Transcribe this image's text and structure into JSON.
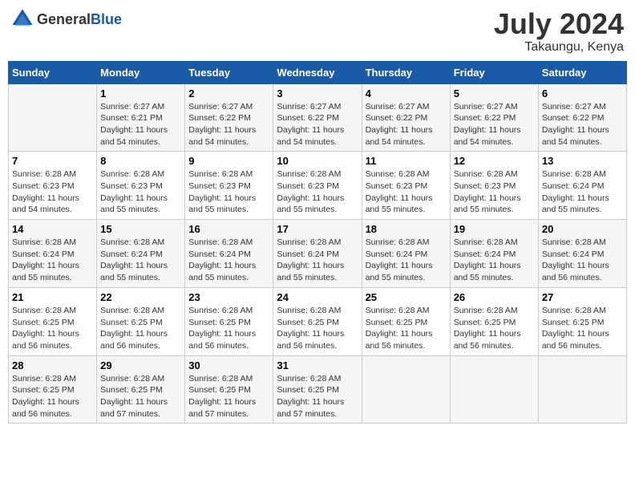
{
  "logo": {
    "general": "General",
    "blue": "Blue"
  },
  "title": "July 2024",
  "location": "Takaungu, Kenya",
  "days_header": [
    "Sunday",
    "Monday",
    "Tuesday",
    "Wednesday",
    "Thursday",
    "Friday",
    "Saturday"
  ],
  "weeks": [
    [
      {
        "day": "",
        "info": ""
      },
      {
        "day": "1",
        "info": "Sunrise: 6:27 AM\nSunset: 6:21 PM\nDaylight: 11 hours\nand 54 minutes."
      },
      {
        "day": "2",
        "info": "Sunrise: 6:27 AM\nSunset: 6:22 PM\nDaylight: 11 hours\nand 54 minutes."
      },
      {
        "day": "3",
        "info": "Sunrise: 6:27 AM\nSunset: 6:22 PM\nDaylight: 11 hours\nand 54 minutes."
      },
      {
        "day": "4",
        "info": "Sunrise: 6:27 AM\nSunset: 6:22 PM\nDaylight: 11 hours\nand 54 minutes."
      },
      {
        "day": "5",
        "info": "Sunrise: 6:27 AM\nSunset: 6:22 PM\nDaylight: 11 hours\nand 54 minutes."
      },
      {
        "day": "6",
        "info": "Sunrise: 6:27 AM\nSunset: 6:22 PM\nDaylight: 11 hours\nand 54 minutes."
      }
    ],
    [
      {
        "day": "7",
        "info": "Sunrise: 6:28 AM\nSunset: 6:23 PM\nDaylight: 11 hours\nand 54 minutes."
      },
      {
        "day": "8",
        "info": "Sunrise: 6:28 AM\nSunset: 6:23 PM\nDaylight: 11 hours\nand 55 minutes."
      },
      {
        "day": "9",
        "info": "Sunrise: 6:28 AM\nSunset: 6:23 PM\nDaylight: 11 hours\nand 55 minutes."
      },
      {
        "day": "10",
        "info": "Sunrise: 6:28 AM\nSunset: 6:23 PM\nDaylight: 11 hours\nand 55 minutes."
      },
      {
        "day": "11",
        "info": "Sunrise: 6:28 AM\nSunset: 6:23 PM\nDaylight: 11 hours\nand 55 minutes."
      },
      {
        "day": "12",
        "info": "Sunrise: 6:28 AM\nSunset: 6:23 PM\nDaylight: 11 hours\nand 55 minutes."
      },
      {
        "day": "13",
        "info": "Sunrise: 6:28 AM\nSunset: 6:24 PM\nDaylight: 11 hours\nand 55 minutes."
      }
    ],
    [
      {
        "day": "14",
        "info": "Sunrise: 6:28 AM\nSunset: 6:24 PM\nDaylight: 11 hours\nand 55 minutes."
      },
      {
        "day": "15",
        "info": "Sunrise: 6:28 AM\nSunset: 6:24 PM\nDaylight: 11 hours\nand 55 minutes."
      },
      {
        "day": "16",
        "info": "Sunrise: 6:28 AM\nSunset: 6:24 PM\nDaylight: 11 hours\nand 55 minutes."
      },
      {
        "day": "17",
        "info": "Sunrise: 6:28 AM\nSunset: 6:24 PM\nDaylight: 11 hours\nand 55 minutes."
      },
      {
        "day": "18",
        "info": "Sunrise: 6:28 AM\nSunset: 6:24 PM\nDaylight: 11 hours\nand 55 minutes."
      },
      {
        "day": "19",
        "info": "Sunrise: 6:28 AM\nSunset: 6:24 PM\nDaylight: 11 hours\nand 55 minutes."
      },
      {
        "day": "20",
        "info": "Sunrise: 6:28 AM\nSunset: 6:24 PM\nDaylight: 11 hours\nand 56 minutes."
      }
    ],
    [
      {
        "day": "21",
        "info": "Sunrise: 6:28 AM\nSunset: 6:25 PM\nDaylight: 11 hours\nand 56 minutes."
      },
      {
        "day": "22",
        "info": "Sunrise: 6:28 AM\nSunset: 6:25 PM\nDaylight: 11 hours\nand 56 minutes."
      },
      {
        "day": "23",
        "info": "Sunrise: 6:28 AM\nSunset: 6:25 PM\nDaylight: 11 hours\nand 56 minutes."
      },
      {
        "day": "24",
        "info": "Sunrise: 6:28 AM\nSunset: 6:25 PM\nDaylight: 11 hours\nand 56 minutes."
      },
      {
        "day": "25",
        "info": "Sunrise: 6:28 AM\nSunset: 6:25 PM\nDaylight: 11 hours\nand 56 minutes."
      },
      {
        "day": "26",
        "info": "Sunrise: 6:28 AM\nSunset: 6:25 PM\nDaylight: 11 hours\nand 56 minutes."
      },
      {
        "day": "27",
        "info": "Sunrise: 6:28 AM\nSunset: 6:25 PM\nDaylight: 11 hours\nand 56 minutes."
      }
    ],
    [
      {
        "day": "28",
        "info": "Sunrise: 6:28 AM\nSunset: 6:25 PM\nDaylight: 11 hours\nand 56 minutes."
      },
      {
        "day": "29",
        "info": "Sunrise: 6:28 AM\nSunset: 6:25 PM\nDaylight: 11 hours\nand 57 minutes."
      },
      {
        "day": "30",
        "info": "Sunrise: 6:28 AM\nSunset: 6:25 PM\nDaylight: 11 hours\nand 57 minutes."
      },
      {
        "day": "31",
        "info": "Sunrise: 6:28 AM\nSunset: 6:25 PM\nDaylight: 11 hours\nand 57 minutes."
      },
      {
        "day": "",
        "info": ""
      },
      {
        "day": "",
        "info": ""
      },
      {
        "day": "",
        "info": ""
      }
    ]
  ]
}
